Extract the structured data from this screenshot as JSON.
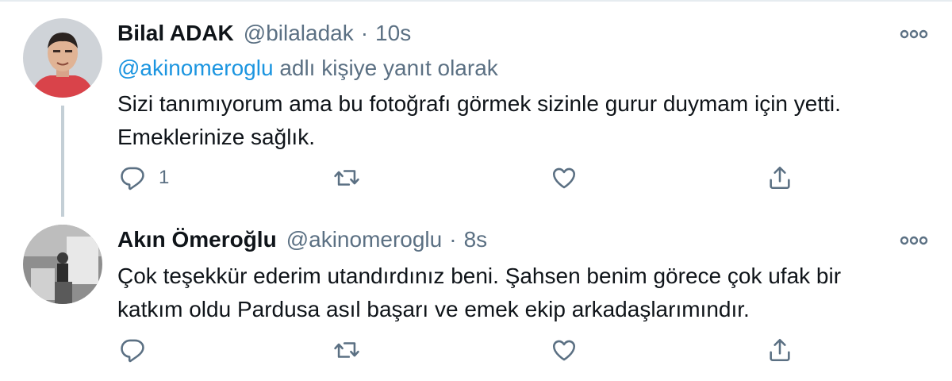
{
  "tweets": [
    {
      "author_name": "Bilal ADAK",
      "handle": "@bilaladak",
      "separator": "·",
      "time": "10s",
      "reply_mention": "@akinomeroglu",
      "reply_suffix": "adlı kişiye yanıt olarak",
      "text_lines": [
        "Sizi tanımıyorum ama bu fotoğrafı görmek sizinle gurur duymam için yetti.",
        "Emeklerinize sağlık."
      ],
      "reply_count": "1",
      "more_icon": "more-dots-icon"
    },
    {
      "author_name": "Akın Ömeroğlu",
      "handle": "@akinomeroglu",
      "separator": "·",
      "time": "8s",
      "text_lines": [
        "Çok teşekkür ederim utandırdınız beni. Şahsen benim görece çok ufak bir",
        "katkım oldu Pardusa asıl başarı ve emek ekip arkadaşlarımındır."
      ],
      "reply_count": "",
      "more_icon": "more-dots-icon"
    }
  ],
  "icons": {
    "reply": "reply-icon",
    "retweet": "retweet-icon",
    "like": "like-icon",
    "share": "share-icon"
  },
  "colors": {
    "text": "#0f1419",
    "secondary": "#5b7083",
    "link": "#1b95e0",
    "thread_line": "#c4cfd6"
  }
}
